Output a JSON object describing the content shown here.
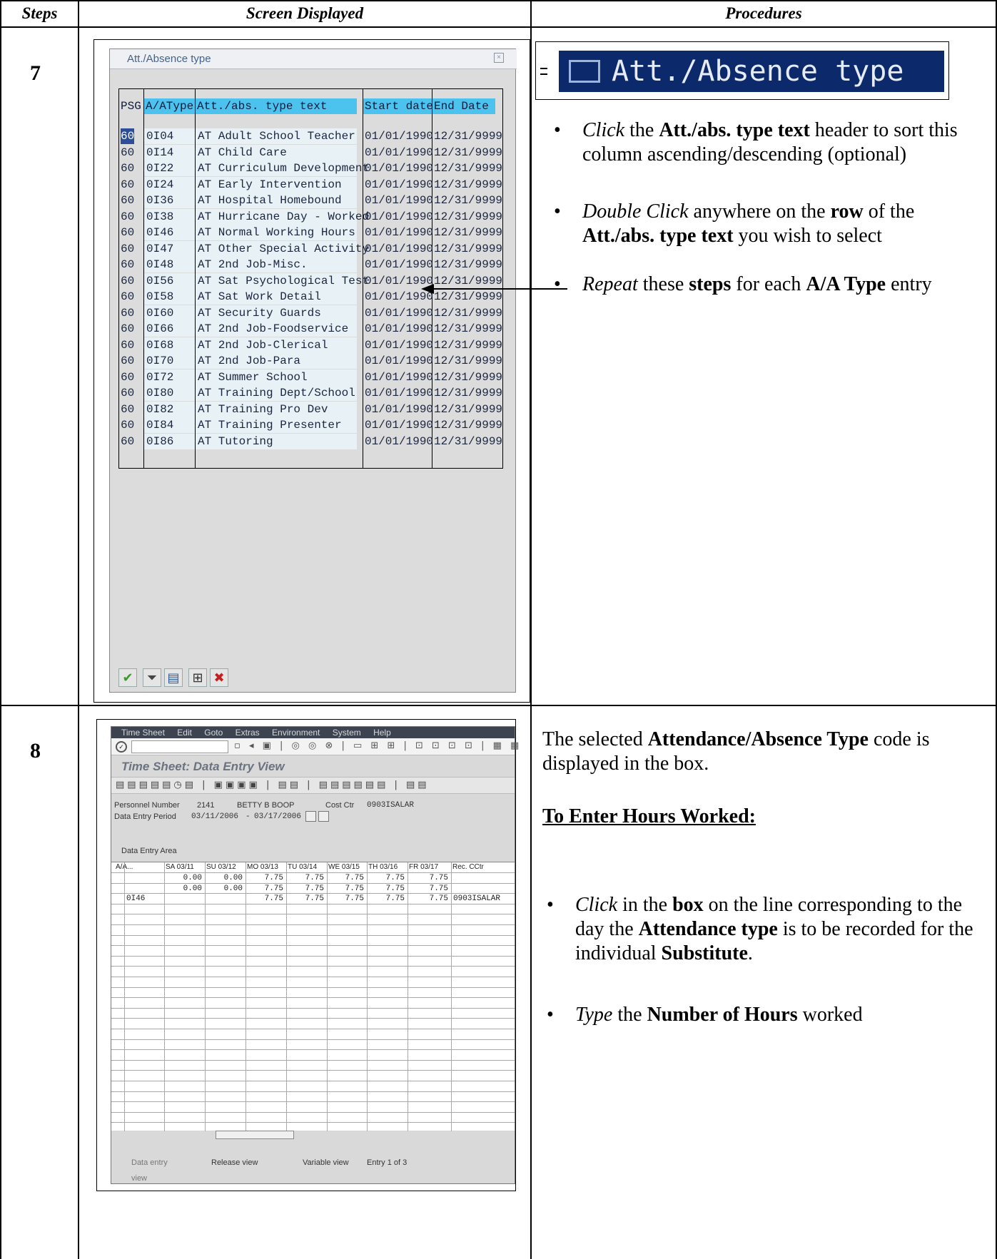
{
  "table_headers": {
    "steps": "Steps",
    "screen": "Screen Displayed",
    "procedures": "Procedures"
  },
  "step7": {
    "number": "7",
    "popup": {
      "title": "Att./Absence type",
      "columns": [
        "PSG",
        "A/AType",
        "Att./abs. type text",
        "Start date",
        "End Date"
      ],
      "rows": [
        [
          "60",
          "0I04",
          "AT Adult School Teacher",
          "01/01/1990",
          "12/31/9999"
        ],
        [
          "60",
          "0I14",
          "AT Child Care",
          "01/01/1990",
          "12/31/9999"
        ],
        [
          "60",
          "0I22",
          "AT Curriculum Development",
          "01/01/1990",
          "12/31/9999"
        ],
        [
          "60",
          "0I24",
          "AT Early Intervention",
          "01/01/1990",
          "12/31/9999"
        ],
        [
          "60",
          "0I36",
          "AT Hospital Homebound",
          "01/01/1990",
          "12/31/9999"
        ],
        [
          "60",
          "0I38",
          "AT Hurricane Day - Worked",
          "01/01/1990",
          "12/31/9999"
        ],
        [
          "60",
          "0I46",
          "AT Normal Working Hours",
          "01/01/1990",
          "12/31/9999"
        ],
        [
          "60",
          "0I47",
          "AT Other Special Activity",
          "01/01/1990",
          "12/31/9999"
        ],
        [
          "60",
          "0I48",
          "AT 2nd Job-Misc.",
          "01/01/1990",
          "12/31/9999"
        ],
        [
          "60",
          "0I56",
          "AT Sat Psychological Test",
          "01/01/1990",
          "12/31/9999"
        ],
        [
          "60",
          "0I58",
          "AT Sat Work Detail",
          "01/01/1990",
          "12/31/9999"
        ],
        [
          "60",
          "0I60",
          "AT Security Guards",
          "01/01/1990",
          "12/31/9999"
        ],
        [
          "60",
          "0I66",
          "AT 2nd Job-Foodservice",
          "01/01/1990",
          "12/31/9999"
        ],
        [
          "60",
          "0I68",
          "AT 2nd Job-Clerical",
          "01/01/1990",
          "12/31/9999"
        ],
        [
          "60",
          "0I70",
          "AT 2nd Job-Para",
          "01/01/1990",
          "12/31/9999"
        ],
        [
          "60",
          "0I72",
          "AT Summer School",
          "01/01/1990",
          "12/31/9999"
        ],
        [
          "60",
          "0I80",
          "AT Training Dept/School",
          "01/01/1990",
          "12/31/9999"
        ],
        [
          "60",
          "0I82",
          "AT Training Pro Dev",
          "01/01/1990",
          "12/31/9999"
        ],
        [
          "60",
          "0I84",
          "AT Training Presenter",
          "01/01/1990",
          "12/31/9999"
        ],
        [
          "60",
          "0I86",
          "AT Tutoring",
          "01/01/1990",
          "12/31/9999"
        ]
      ]
    },
    "callout_text": "Att./Absence type",
    "procedures": [
      {
        "em": "Click",
        "t1": " the ",
        "b1": "Att./abs. type text",
        "t2": " header to sort this column ascending/descending (optional)"
      },
      {
        "em": "Double Click",
        "t1": " anywhere on the ",
        "b1": "row",
        "t2": " of the ",
        "b2": "Att./abs. type text",
        "t3": " you wish to select"
      },
      {
        "em": "Repeat",
        "t1": " these ",
        "b1": "steps",
        "t2": " for each ",
        "b2": "A/A Type",
        "t3": " entry"
      }
    ]
  },
  "step8": {
    "number": "8",
    "timesheet": {
      "menu": [
        "Time Sheet",
        "Edit",
        "Goto",
        "Extras",
        "Environment",
        "System",
        "Help"
      ],
      "title": "Time Sheet: Data Entry View",
      "personnel_label": "Personnel Number",
      "personnel_number": "2141",
      "employee_name": "BETTY B BOOP",
      "cost_ctr_label": "Cost Ctr",
      "cost_ctr": "0903ISALAR",
      "period_label": "Data Entry Period",
      "period_from": "03/11/2006",
      "period_sep": "-",
      "period_to": "03/17/2006",
      "area_label": "Data Entry Area",
      "grid_headers": [
        "A/A...",
        "SA 03/11",
        "SU 03/12",
        "MO 03/13",
        "TU 03/14",
        "WE 03/15",
        "TH 03/16",
        "FR 03/17",
        "Rec. CCtr"
      ],
      "grid_rows": [
        [
          "",
          "0.00",
          "0.00",
          "7.75",
          "7.75",
          "7.75",
          "7.75",
          "7.75",
          ""
        ],
        [
          "",
          "0.00",
          "0.00",
          "7.75",
          "7.75",
          "7.75",
          "7.75",
          "7.75",
          ""
        ],
        [
          "0I46",
          "",
          "",
          "7.75",
          "7.75",
          "7.75",
          "7.75",
          "7.75",
          "0903ISALAR"
        ]
      ],
      "tabs": [
        "Data entry view",
        "Release view",
        "Variable view"
      ],
      "entry_status": "Entry 1 of 3"
    },
    "intro": {
      "t1": "The selected ",
      "b1": "Attendance/Absence Type",
      "t2": " code is displayed in the box."
    },
    "subheading": "To Enter Hours Worked:",
    "procedures": [
      {
        "em": "Click",
        "t1": " in the ",
        "b1": "box",
        "t2": " on the line corresponding to the day the ",
        "b2": "Attendance type",
        "t3": " is to be recorded for the individual ",
        "b3": "Substitute",
        "t4": "."
      },
      {
        "em": "Type",
        "t1": " the ",
        "b1": "Number of Hours",
        "t2": " worked"
      }
    ]
  },
  "colors": {
    "highlight_header": "#4cc3ee",
    "title_bar": "#0c2a6b",
    "grid_bg": "#dcdcdc"
  }
}
